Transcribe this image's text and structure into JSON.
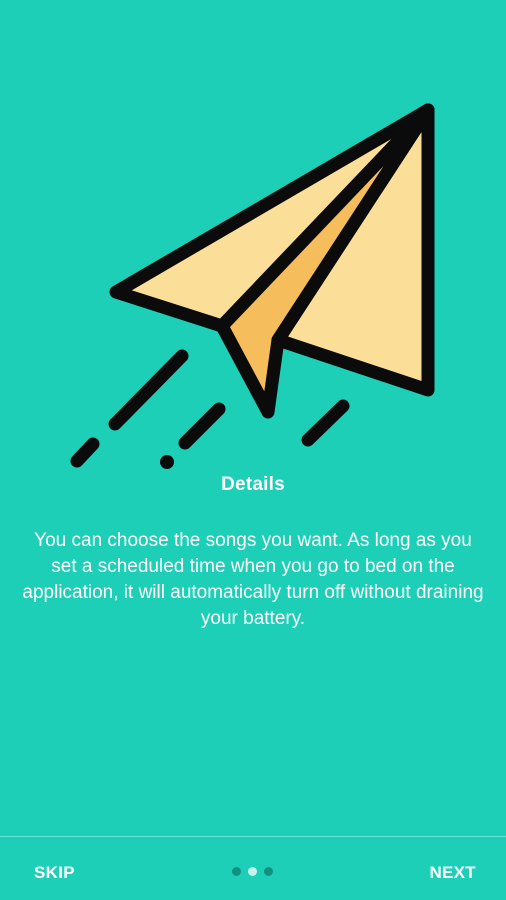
{
  "onboarding": {
    "illustration": "paper-plane-icon",
    "title": "Details",
    "description": "You can choose the songs you want. As long as you set a scheduled time when you go to bed on the application, it will automatically turn off without draining your battery."
  },
  "navigation": {
    "skip_label": "SKIP",
    "next_label": "NEXT",
    "page_count": 3,
    "current_page": 2
  },
  "colors": {
    "background": "#1dcfb7",
    "plane_fill": "#fbdf98",
    "plane_fold": "#f5bd5c",
    "outline": "#0b0b0b",
    "text": "#ffffff"
  }
}
